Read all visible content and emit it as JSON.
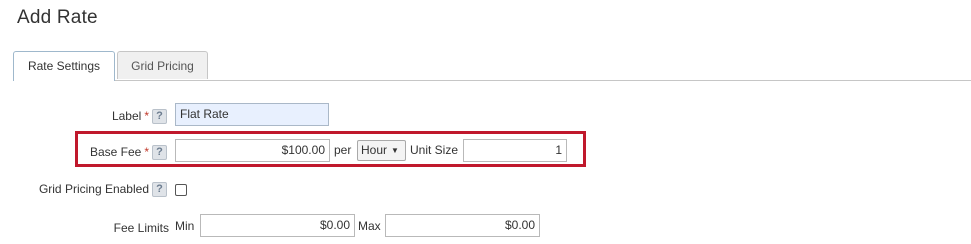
{
  "page": {
    "title": "Add Rate"
  },
  "tabs": [
    {
      "label": "Rate Settings",
      "active": true
    },
    {
      "label": "Grid Pricing",
      "active": false
    }
  ],
  "form": {
    "label_field": {
      "label": "Label",
      "required_mark": "*",
      "help": "?",
      "value": "Flat Rate"
    },
    "base_fee": {
      "label": "Base Fee",
      "required_mark": "*",
      "help": "?",
      "value": "$100.00",
      "per_text": "per",
      "unit_selected": "Hour",
      "unit_size_label": "Unit Size",
      "unit_size_value": "1"
    },
    "grid_pricing": {
      "label": "Grid Pricing Enabled",
      "help": "?",
      "checked": false
    },
    "fee_limits": {
      "label": "Fee Limits",
      "min_label": "Min",
      "min_value": "$0.00",
      "max_label": "Max",
      "max_value": "$0.00"
    }
  },
  "colors": {
    "highlight_border": "#c0182c",
    "required": "#c0392b",
    "label_input_bg": "#e8f0fe"
  }
}
